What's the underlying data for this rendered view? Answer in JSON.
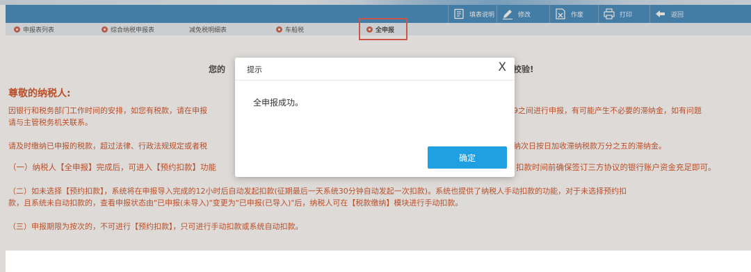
{
  "toolbar": {
    "fill_guide": "填表说明",
    "edit": "修改",
    "void": "作废",
    "print": "打印",
    "back": "返回"
  },
  "tabs": [
    {
      "label": "申报表列表",
      "icon": "gear-dot"
    },
    {
      "label": "综合纳税申报表",
      "icon": "gear-dot"
    },
    {
      "label": "减免税明细表",
      "icon": ""
    },
    {
      "label": "车船税",
      "icon": "gear-dot"
    },
    {
      "label": "全申报",
      "icon": "gear-dot",
      "active": true
    }
  ],
  "content": {
    "headline_left": "您的",
    "headline_right": "校验!",
    "dear": "尊敬的纳税人:",
    "p1_left": "因银行和税务部门工作时间的安排，如您有税款，请在申报",
    "p1_right": "9之间进行申报，有可能产生不必要的滞纳金，如有问题",
    "p1_line2": "请与主管税务机关联系。",
    "p2_left": "请及时缴纳已申报的税款，超过法律、行政法规规定或者税",
    "p2_right": "纳次日按日加收滞纳税款万分之五的滞纳金。",
    "p3_left": "（一）纳税人【全申报】完成后，可进入【预约扣款】功能",
    "p3_right": "扣款时间前确保签订三方协议的银行账户资金充足即可。",
    "p4_line1": "（二）如未选择【预约扣款】，系统将在申报导入完成的12小时后自动发起扣款(征期最后一天系统30分钟自动发起一次扣款)。系统也提供了纳税人手动扣款的功能，对于未选择预约扣",
    "p4_line2": "款，且系统未自动扣款的，查看申报状态由\"已申报(未导入)\"变更为\"已申报(已导入)\"后，纳税人可在【税款缴纳】模块进行手动扣款。",
    "p5": "（三）申报期限为按次的，不可进行【预约扣款】，只可进行手动扣款或系统自动扣款。"
  },
  "dialog": {
    "title": "提示",
    "close": "X",
    "message": "全申报成功。",
    "confirm": "确定"
  },
  "colors": {
    "toolbar_bg": "#1d75b6",
    "tab_strip_bg": "#e4eef7",
    "notice_text": "#cc3300",
    "confirm_button": "#1fa0e3",
    "highlight_box": "#e53c2e"
  }
}
